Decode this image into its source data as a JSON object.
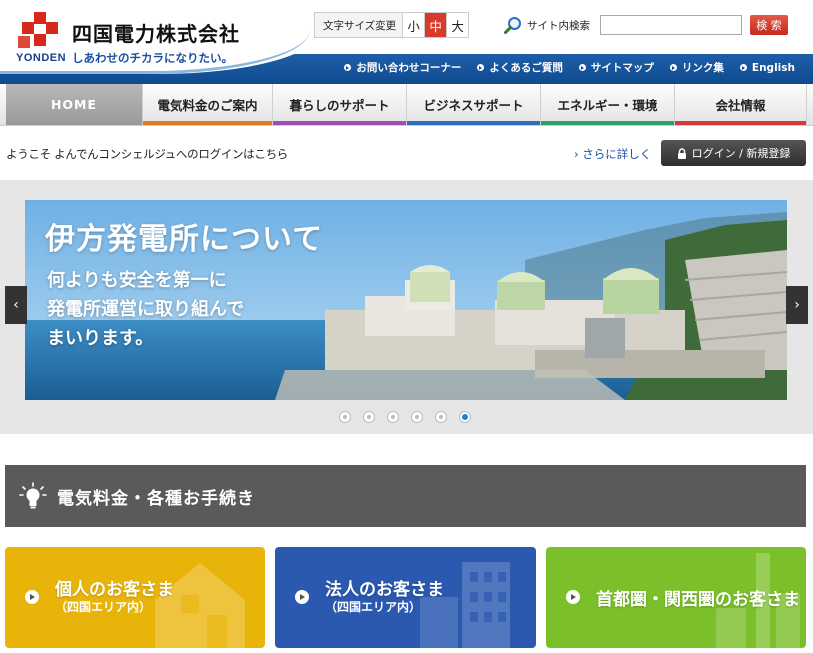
{
  "header": {
    "logo_name": "四国電力株式会社",
    "logo_romaji": "YONDEN",
    "tagline": "しあわせのチカラになりたい。",
    "font_size_label": "文字サイズ変更",
    "font_sizes": [
      "小",
      "中",
      "大"
    ],
    "font_size_selected": "中",
    "search_label": "サイト内検索",
    "search_placeholder": "",
    "search_button": "検 索",
    "utility_links": [
      "お問い合わせコーナー",
      "よくあるご質問",
      "サイトマップ",
      "リンク集",
      "English"
    ]
  },
  "global_nav": [
    {
      "label": "HOME",
      "color": "#9a9a9a"
    },
    {
      "label": "電気料金のご案内",
      "color": "#e07a1f"
    },
    {
      "label": "暮らしのサポート",
      "color": "#9c4fb5"
    },
    {
      "label": "ビジネスサポート",
      "color": "#2b6fc0"
    },
    {
      "label": "エネルギー・環境",
      "color": "#2aa06a"
    },
    {
      "label": "会社情報",
      "color": "#d23a3a"
    }
  ],
  "welcome": {
    "text": "ようこそ よんでんコンシェルジュへのログインはこちら",
    "more_link": "さらに詳しく",
    "login_button": "ログイン / 新規登録"
  },
  "slider": {
    "title": "伊方発電所について",
    "body": "何よりも安全を第一に\n発電所運営に取り組んで\nまいります。",
    "prev": "‹",
    "next": "›",
    "dots": 6,
    "active_dot": 6
  },
  "section": {
    "title": "電気料金・各種お手続き"
  },
  "cards": [
    {
      "title": "個人のお客さま",
      "subtitle": "（四国エリア内）",
      "color": "#e9b40a"
    },
    {
      "title": "法人のお客さま",
      "subtitle": "（四国エリア内）",
      "color": "#2b59b0"
    },
    {
      "title": "首都圏・関西圏のお客さま",
      "subtitle": "",
      "color": "#7bc02a"
    }
  ],
  "colors": {
    "brand_red": "#d8281b",
    "brand_blue": "#1a4c8f"
  }
}
